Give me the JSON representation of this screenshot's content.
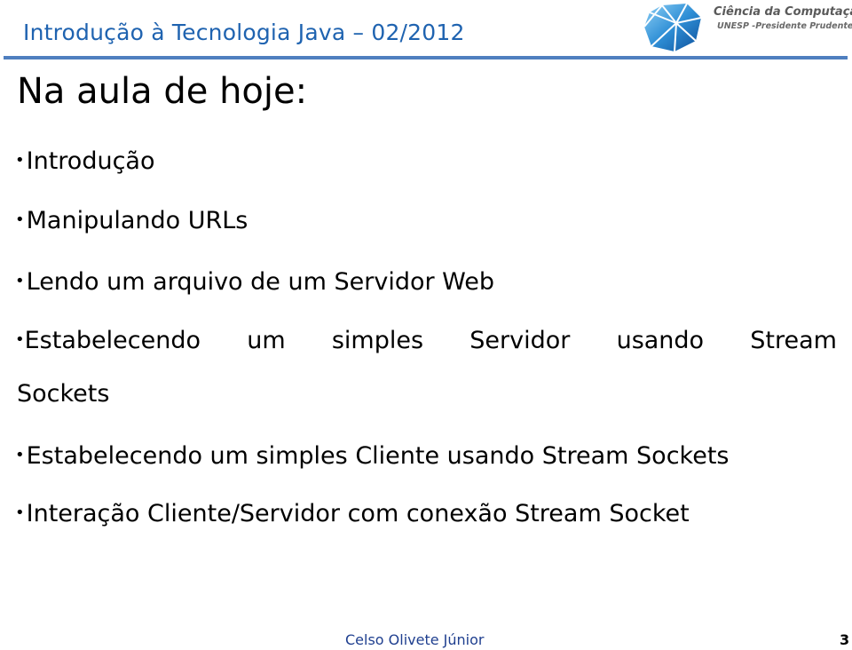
{
  "header": {
    "title": "Introdução à Tecnologia Java – 02/2012",
    "logo_icon": "unesp-globe-logo-icon",
    "logo_line1": "Ciência da Computação",
    "logo_line2": "UNESP -Presidente Prudente",
    "rule_color": "#4f7fbf",
    "title_color": "#1f63b0"
  },
  "slide": {
    "title": "Na aula de hoje:",
    "bullet_glyph": "•",
    "items": [
      {
        "text": "Introdução"
      },
      {
        "text": "Manipulando URLs"
      },
      {
        "text": "Lendo um arquivo de um Servidor Web"
      },
      {
        "words": [
          "Estabelecendo",
          "um",
          "simples",
          "Servidor",
          "usando",
          "Stream"
        ],
        "continuation": "Sockets"
      },
      {
        "text": "Estabelecendo um simples Cliente usando Stream Sockets"
      },
      {
        "text": "Interação Cliente/Servidor com conexão Stream Socket"
      }
    ]
  },
  "footer": {
    "author": "Celso Olivete Júnior",
    "page_number": "3"
  }
}
